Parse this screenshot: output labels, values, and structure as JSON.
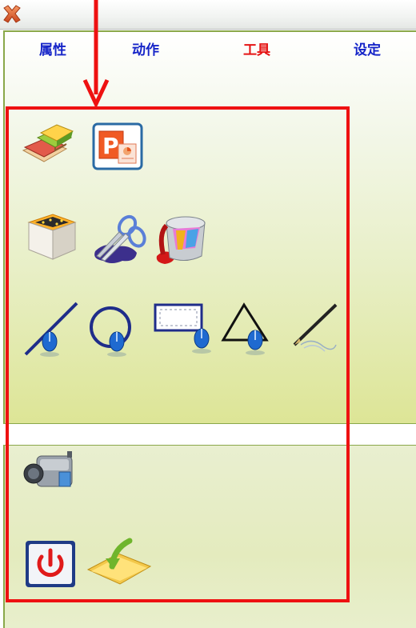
{
  "window": {
    "close_icon": "close-x-icon"
  },
  "tabs": [
    {
      "label": "属性",
      "active": false
    },
    {
      "label": "动作",
      "active": false
    },
    {
      "label": "工具",
      "active": true
    },
    {
      "label": "设定",
      "active": false
    }
  ],
  "colors": {
    "tab_text": "#1524c8",
    "tab_active": "#e51414",
    "highlight_frame": "#ee1111",
    "panel_border": "#8aa84a"
  },
  "tools": {
    "row1": [
      "books-icon",
      "powerpoint-icon"
    ],
    "row2": [
      "box-icon",
      "scissors-icon",
      "paint-bucket-icon"
    ],
    "row3": [
      "draw-line-icon",
      "draw-circle-icon",
      "draw-rectangle-icon",
      "draw-triangle-icon",
      "pen-icon"
    ],
    "row4": [
      "video-camera-icon"
    ],
    "row5": [
      "power-icon",
      "folder-import-icon"
    ]
  }
}
